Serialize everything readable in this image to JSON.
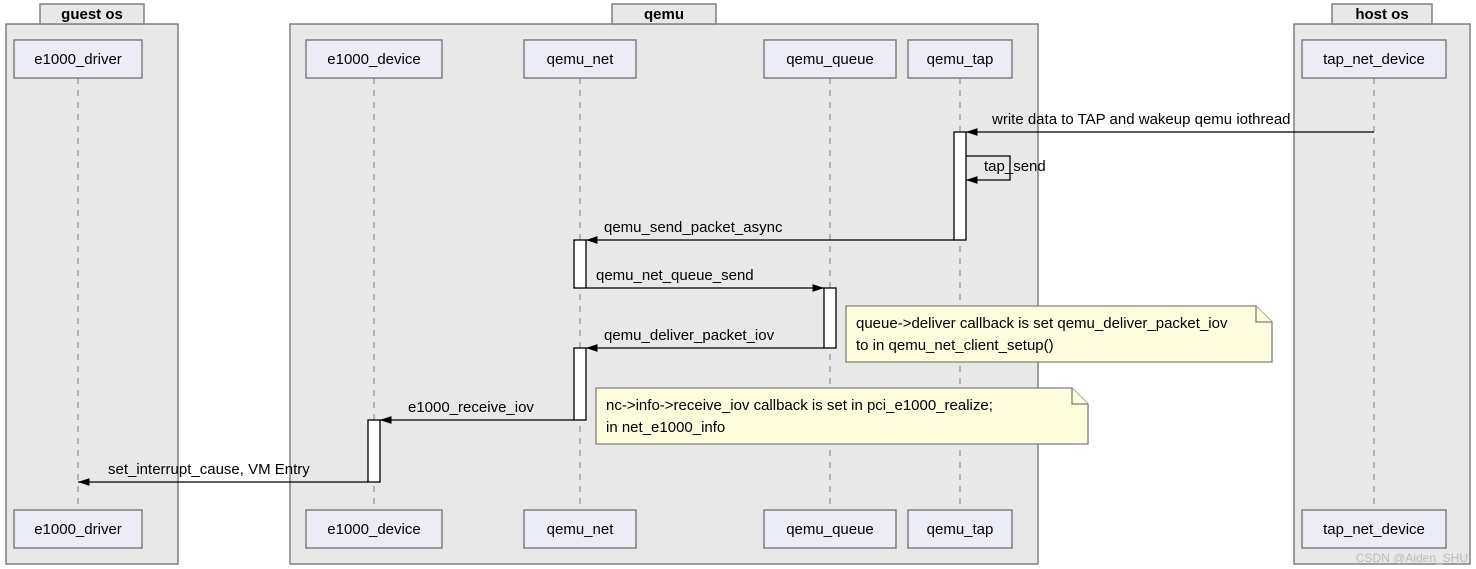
{
  "groups": {
    "guest": {
      "title": "guest os"
    },
    "qemu": {
      "title": "qemu"
    },
    "host": {
      "title": "host os"
    }
  },
  "participants": {
    "driver": {
      "label": "e1000_driver"
    },
    "device": {
      "label": "e1000_device"
    },
    "net": {
      "label": "qemu_net"
    },
    "queue": {
      "label": "qemu_queue"
    },
    "tap": {
      "label": "qemu_tap"
    },
    "tapdev": {
      "label": "tap_net_device"
    }
  },
  "messages": {
    "m1": {
      "label": "write data to TAP and wakeup qemu iothread"
    },
    "m2": {
      "label": "tap_send"
    },
    "m3": {
      "label": "qemu_send_packet_async"
    },
    "m4": {
      "label": "qemu_net_queue_send"
    },
    "m5": {
      "label": "qemu_deliver_packet_iov"
    },
    "m6": {
      "label": "e1000_receive_iov"
    },
    "m7": {
      "label": "set_interrupt_cause, VM Entry"
    }
  },
  "notes": {
    "n1_a": "queue->deliver callback is set qemu_deliver_packet_iov",
    "n1_b": "to in qemu_net_client_setup()",
    "n2_a": "nc->info->receive_iov callback is set in pci_e1000_realize;",
    "n2_b": "in net_e1000_info"
  },
  "watermark": "CSDN @Aiden_SHU"
}
